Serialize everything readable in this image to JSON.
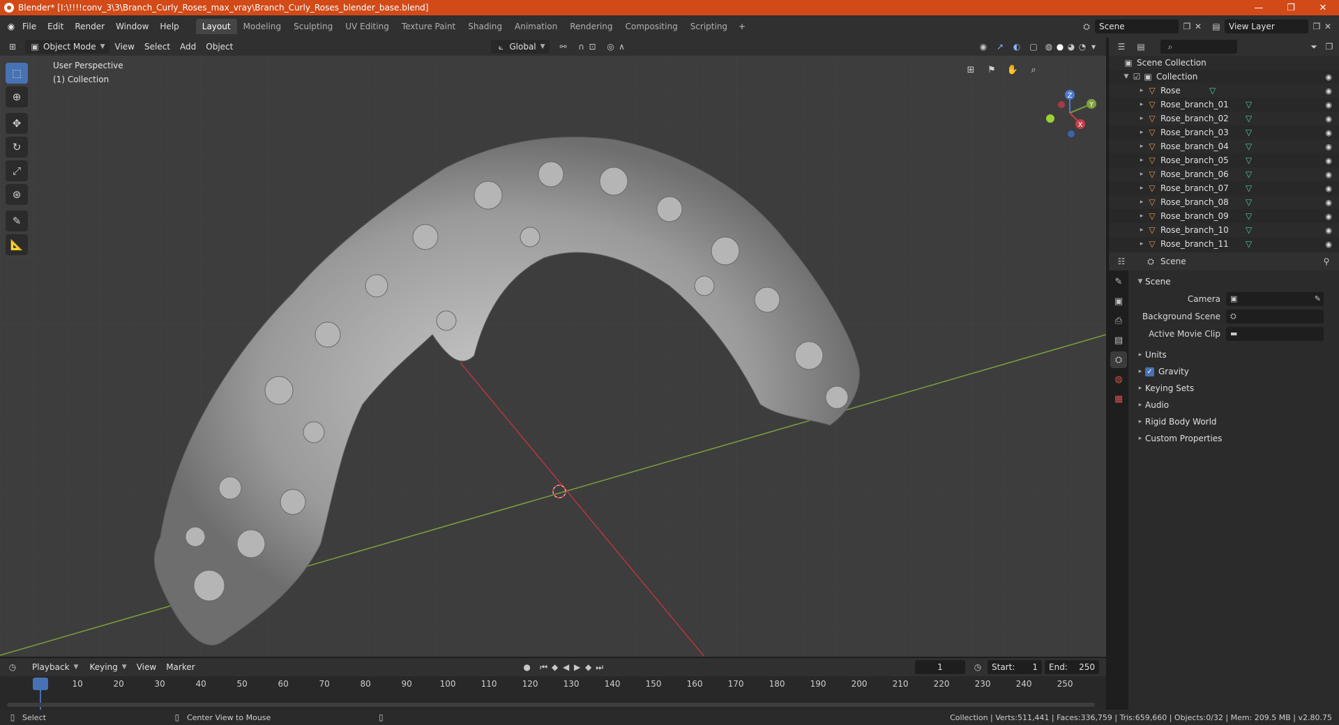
{
  "window": {
    "title": "Blender* [I:\\!!!!conv_3\\3\\Branch_Curly_Roses_max_vray\\Branch_Curly_Roses_blender_base.blend]",
    "controls": [
      "—",
      "❐",
      "✕"
    ]
  },
  "menu": [
    "File",
    "Edit",
    "Render",
    "Window",
    "Help"
  ],
  "workspaces": [
    "Layout",
    "Modeling",
    "Sculpting",
    "UV Editing",
    "Texture Paint",
    "Shading",
    "Animation",
    "Rendering",
    "Compositing",
    "Scripting"
  ],
  "active_workspace": "Layout",
  "scene_field": "Scene",
  "view_layer_field": "View Layer",
  "viewport_header": {
    "mode": "Object Mode",
    "menus": [
      "View",
      "Select",
      "Add",
      "Object"
    ],
    "orientation": "Global"
  },
  "viewport": {
    "perspective": "User Perspective",
    "collection": "(1) Collection",
    "gizmo": {
      "x": "X",
      "y": "Y",
      "z": "Z"
    }
  },
  "outliner": {
    "root": "Scene Collection",
    "collection": "Collection",
    "items": [
      "Rose",
      "Rose_branch_01",
      "Rose_branch_02",
      "Rose_branch_03",
      "Rose_branch_04",
      "Rose_branch_05",
      "Rose_branch_06",
      "Rose_branch_07",
      "Rose_branch_08",
      "Rose_branch_09",
      "Rose_branch_10",
      "Rose_branch_11"
    ]
  },
  "properties": {
    "context": "Scene",
    "section": "Scene",
    "fields": [
      {
        "label": "Camera"
      },
      {
        "label": "Background Scene"
      },
      {
        "label": "Active Movie Clip"
      }
    ],
    "subsections": [
      "Units",
      "Gravity",
      "Keying Sets",
      "Audio",
      "Rigid Body World",
      "Custom Properties"
    ],
    "gravity_checked": true
  },
  "timeline": {
    "menus": [
      "Playback",
      "Keying",
      "View",
      "Marker"
    ],
    "current_frame": "1",
    "start_label": "Start:",
    "start": "1",
    "end_label": "End:",
    "end": "250",
    "ticks": [
      "1",
      "10",
      "20",
      "30",
      "40",
      "50",
      "60",
      "70",
      "80",
      "90",
      "100",
      "110",
      "120",
      "130",
      "140",
      "150",
      "160",
      "170",
      "180",
      "190",
      "200",
      "210",
      "220",
      "230",
      "240",
      "250"
    ]
  },
  "statusbar": {
    "left": "Select",
    "middle": "Center View to Mouse",
    "right": "Collection | Verts:511,441 | Faces:336,759 | Tris:659,660 | Objects:0/32 | Mem: 209.5 MB | v2.80.75"
  },
  "colors": {
    "titlebar": "#d14a18",
    "x_axis": "#b8363e",
    "y_axis": "#7ea13b",
    "accent": "#4772b3"
  }
}
